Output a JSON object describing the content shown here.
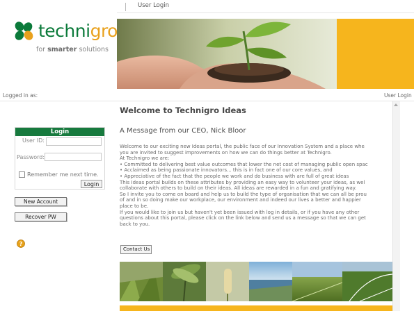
{
  "brand": {
    "name_part1": "techni",
    "name_part2": "gro",
    "tagline_pre": "for ",
    "tagline_bold": "smarter",
    "tagline_post": " solutions"
  },
  "topnav": {
    "user_login_link": "User Login"
  },
  "status": {
    "logged_in_label": "Logged in as:",
    "user_login_right": "User Login"
  },
  "login": {
    "title": "Login",
    "user_id_label": "User ID:",
    "user_id_value": "",
    "password_label": "Password:",
    "password_value": "",
    "remember_label": "Remember me next time.",
    "remember_checked": false,
    "login_button": "Login"
  },
  "sidebar": {
    "new_account_button": "New Account",
    "recover_pw_button": "Recover PW",
    "help_icon": "help-icon"
  },
  "main": {
    "welcome_title": "Welcome to Technigro Ideas",
    "ceo_heading": "A Message from our CEO, Nick Bloor",
    "body_lines": [
      "Welcome to our exciting new Ideas portal, the public face of our Innovation System and a place whe",
      "you are invited to suggest improvements on how we can do things better at Technigro.",
      "At Technigro we are:",
      "• Committed to delivering best value outcomes that lower the net cost of managing public open spac",
      "• Acclaimed as being passionate innovators... this is in fact one of our core values, and",
      "• Appreciative of the fact that the people we work and do business with are full of great ideas",
      "This Ideas portal builds on these attributes by providing an easy way to volunteer your ideas, as wel",
      "collaborate with others to build on their ideas. All ideas are rewarded in a fun and gratifying way.",
      "So I invite you to come on board and help us to build the type of organisation that we can all be prou",
      "of and in so doing make our workplace, our environment and indeed our lives a better and happier",
      "place to be.",
      "If you would like to join us but haven't yet been issued with log in details, or if you have any other",
      "questions about this portal, please click on the link below and send us a message so that we can get",
      "back to you."
    ],
    "contact_button": "Contact Us"
  },
  "colors": {
    "brand_green": "#177a3e",
    "brand_orange": "#f6b51d"
  }
}
